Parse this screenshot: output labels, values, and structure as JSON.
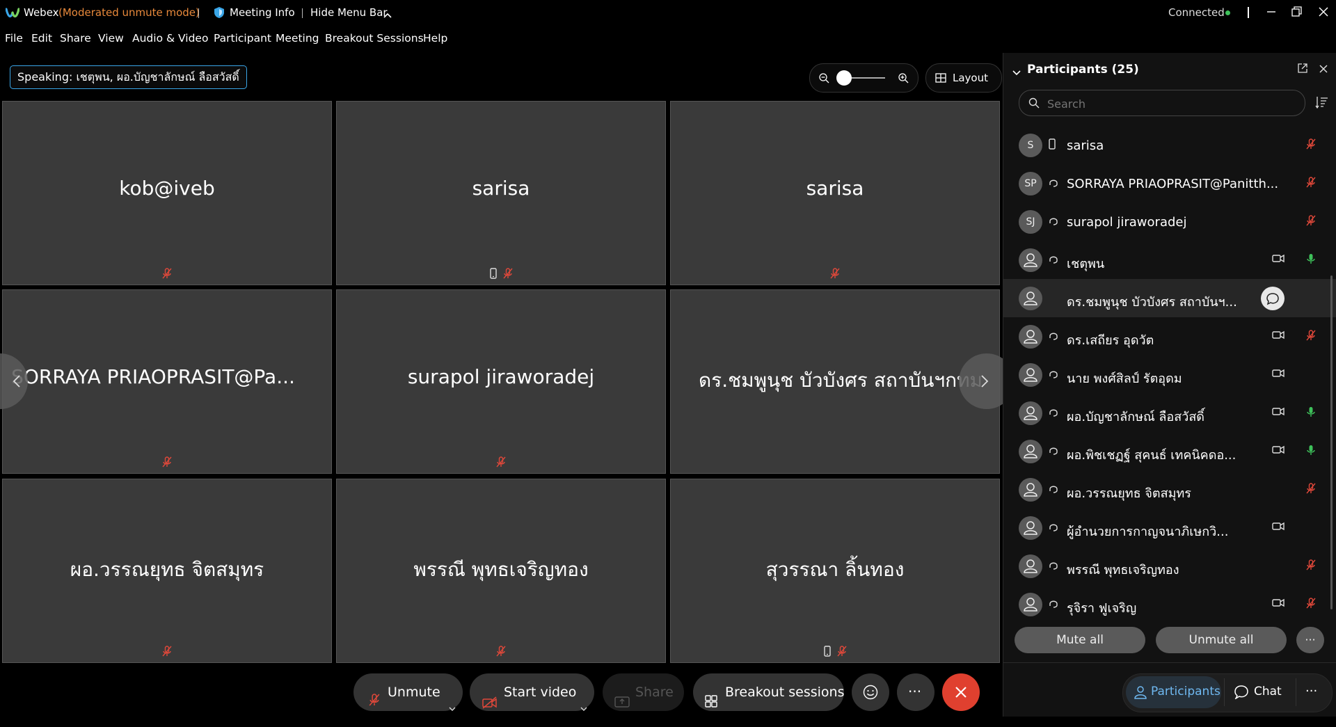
{
  "titlebar": {
    "app": "Webex",
    "mode": "(Moderated unmute mode)",
    "meeting_info": "Meeting Info",
    "hide_menu": "Hide Menu Bar",
    "connection": "Connected"
  },
  "menu": [
    "File",
    "Edit",
    "Share",
    "View",
    "Audio & Video",
    "Participant",
    "Meeting",
    "Breakout Sessions",
    "Help"
  ],
  "speaking": "Speaking: เชตุพน, ผอ.บัญชาลักษณ์ ลือสวัสดิ์",
  "layout_label": "Layout",
  "tiles": [
    {
      "name": "kob@iveb"
    },
    {
      "name": "sarisa"
    },
    {
      "name": "sarisa"
    },
    {
      "name": "SORRAYA PRIAOPRASIT@Pa..."
    },
    {
      "name": "surapol jiraworadej"
    },
    {
      "name": "ดร.ชมพูนุช บัวบังศร สถาบันฯกทม"
    },
    {
      "name": "ผอ.วรรณยุทธ จิตสมุทร"
    },
    {
      "name": "พรรณี พุทธเจริญทอง"
    },
    {
      "name": "สุวรรณา ลิ้นทอง"
    }
  ],
  "panel": {
    "title": "Participants (25)",
    "search_placeholder": "Search",
    "participants": [
      {
        "initials": "S",
        "name": "sarisa"
      },
      {
        "initials": "SP",
        "name": "SORRAYA PRIAOPRASIT@Panitth..."
      },
      {
        "initials": "SJ",
        "name": "surapol jiraworadej"
      },
      {
        "initials": "",
        "name": "เชตุพน"
      },
      {
        "initials": "",
        "name": "ดร.ชมพูนุช บัวบังศร สถาบันฯ..."
      },
      {
        "initials": "",
        "name": "ดร.เสถียร อุดวัต"
      },
      {
        "initials": "",
        "name": "นาย พงศ์สิลป์ รัตอุดม"
      },
      {
        "initials": "",
        "name": "ผอ.บัญชาลักษณ์ ลือสวัสดิ์"
      },
      {
        "initials": "",
        "name": "ผอ.พิชเชฏฐ์ สุคนธ์ เทคนิคดอ..."
      },
      {
        "initials": "",
        "name": "ผอ.วรรณยุทธ จิตสมุทร"
      },
      {
        "initials": "",
        "name": "ผู้อำนวยการกาญจนาภิเษกวิ..."
      },
      {
        "initials": "",
        "name": "พรรณี พุทธเจริญทอง"
      },
      {
        "initials": "",
        "name": "รุจิรา ฟูเจริญ"
      }
    ],
    "mute_all": "Mute all",
    "unmute_all": "Unmute all"
  },
  "bottom": {
    "unmute": "Unmute",
    "start_video": "Start video",
    "share": "Share",
    "breakout": "Breakout sessions",
    "participants_tab": "Participants",
    "chat_tab": "Chat"
  },
  "colors": {
    "muted": "#e0483a",
    "unmuted": "#3ec15a",
    "accent_blue": "#3aa6e8",
    "end_call": "#e0402f",
    "connected_dot": "#3ec15a"
  }
}
